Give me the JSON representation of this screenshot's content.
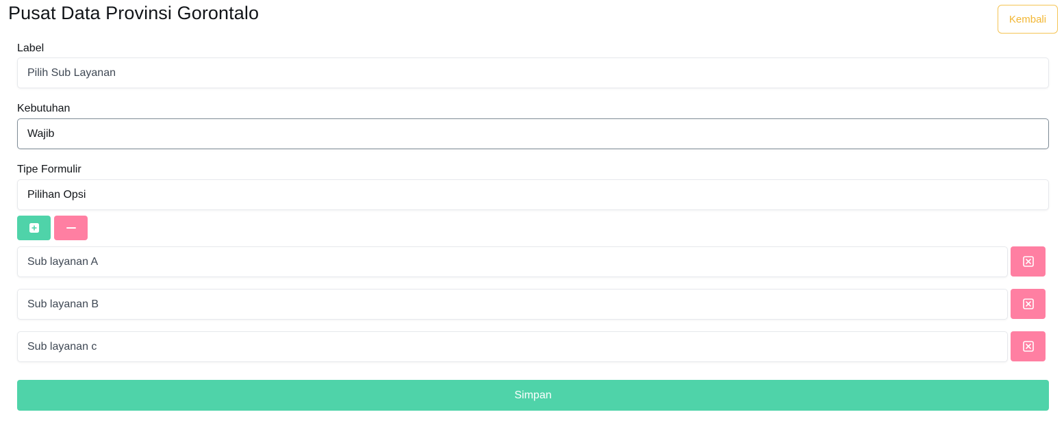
{
  "header": {
    "title": "Pusat Data Provinsi Gorontalo",
    "back_label": "Kembali"
  },
  "form": {
    "label_field": {
      "label": "Label",
      "value": "Pilih Sub Layanan"
    },
    "requirement_field": {
      "label": "Kebutuhan",
      "value": "Wajib"
    },
    "form_type_field": {
      "label": "Tipe Formulir",
      "value": "Pilihan Opsi"
    },
    "options": [
      {
        "value": "Sub layanan A"
      },
      {
        "value": "Sub layanan B"
      },
      {
        "value": "Sub layanan c"
      }
    ],
    "save_label": "Simpan"
  },
  "colors": {
    "accent_green": "#4fd3a9",
    "accent_pink": "#ff7fa2",
    "back_yellow": "#f2b632"
  },
  "icons": {
    "add": "plus-square-icon",
    "remove_all": "minus-icon",
    "remove_item": "close-square-icon"
  }
}
